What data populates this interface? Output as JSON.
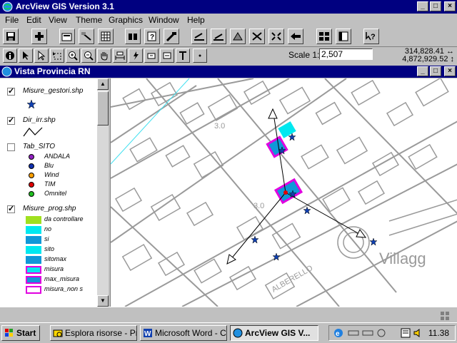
{
  "app": {
    "title": "ArcView GIS Version 3.1"
  },
  "window_buttons": {
    "minimize": "_",
    "maximize": "□",
    "close": "×"
  },
  "menu": [
    "File",
    "Edit",
    "View",
    "Theme",
    "Graphics",
    "Window",
    "Help"
  ],
  "toolbar": {
    "buttons": [
      "save-icon",
      "add-theme-icon",
      "theme-properties-icon",
      "edit-legend-icon",
      "open-table-icon",
      "find-icon",
      "locate-icon",
      "query-builder-icon",
      "build-icon",
      "select-features-icon",
      "clear-selection-icon",
      "zoom-to-full-icon",
      "zoom-to-themes-icon",
      "zoom-to-selected-icon",
      "zoom-previous-icon",
      "layout-icon",
      "table-icon",
      "help-icon"
    ]
  },
  "tools": {
    "scale_label": "Scale 1:",
    "scale_value": "2,507",
    "coord_x": "314,828.41 ↔",
    "coord_y": "4,872,929.52 ↕"
  },
  "view": {
    "title": "Vista Provincia RN",
    "themes": [
      {
        "name": "Misure_gestori.shp",
        "checked": true
      },
      {
        "name": "Dir_irr.shp",
        "checked": true
      },
      {
        "name": "Tab_SITO",
        "checked": false,
        "classes": [
          {
            "label": "ANDALA",
            "color": "#9020c0"
          },
          {
            "label": "Blu",
            "color": "#1030b0"
          },
          {
            "label": "Wind",
            "color": "#ffa000"
          },
          {
            "label": "TIM",
            "color": "#e00000"
          },
          {
            "label": "Omnitel",
            "color": "#20c020"
          }
        ]
      },
      {
        "name": "Misure_prog.shp",
        "checked": true,
        "classes": [
          {
            "label": "da controllare",
            "color": "#a0e020",
            "border": "#a0e020"
          },
          {
            "label": "no",
            "color": "#00e8f0",
            "border": "#00e8f0"
          },
          {
            "label": "si",
            "color": "#1098d8",
            "border": "#1098d8"
          },
          {
            "label": "sito",
            "color": "#00e8f0",
            "border": "#00e8f0"
          },
          {
            "label": "sitomax",
            "color": "#1098d8",
            "border": "#1098d8"
          },
          {
            "label": "misura",
            "color": "#00e8f0",
            "border": "#e000e0"
          },
          {
            "label": "max_misura",
            "color": "#1098d8",
            "border": "#e000e0"
          },
          {
            "label": "misura_non s",
            "color": "#ffffff",
            "border": "#e000e0"
          }
        ]
      }
    ],
    "map_labels": {
      "village": "Villagg",
      "street": "ALBERELLO",
      "elev1": "3.0",
      "elev2": "3.0"
    }
  },
  "taskbar": {
    "start": "Start",
    "tasks": [
      "Esplora risorse - Pr...",
      "Microsoft Word - C...",
      "ArcView GIS V..."
    ],
    "clock": "11.38"
  }
}
